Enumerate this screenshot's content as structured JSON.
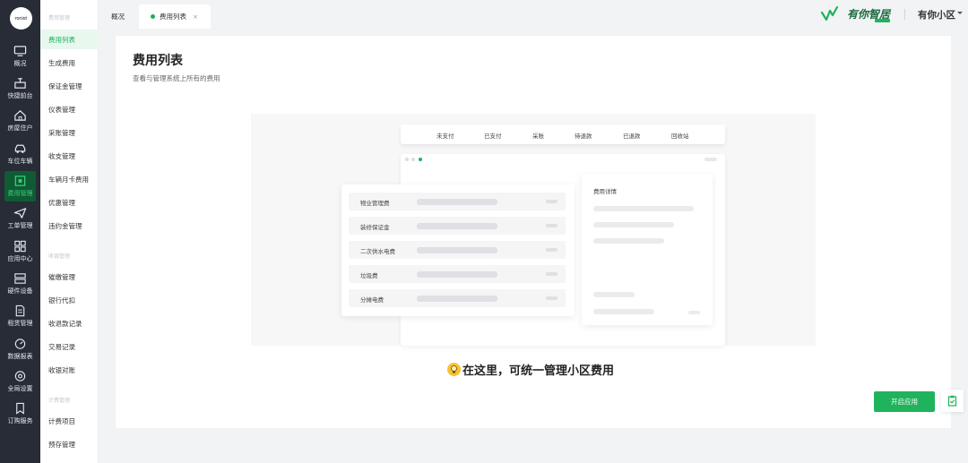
{
  "logo": {
    "text": "roniot"
  },
  "rail": {
    "items": [
      {
        "label": "概况",
        "icon": "monitor-icon"
      },
      {
        "label": "快捷前台",
        "icon": "desk-icon"
      },
      {
        "label": "房屋住户",
        "icon": "house-icon"
      },
      {
        "label": "车位车辆",
        "icon": "car-icon"
      },
      {
        "label": "费用管理",
        "icon": "fee-icon",
        "active": true
      },
      {
        "label": "工单管理",
        "icon": "paper-plane-icon"
      },
      {
        "label": "应用中心",
        "icon": "apps-grid-icon"
      },
      {
        "label": "硬件设备",
        "icon": "server-icon"
      },
      {
        "label": "租赁管理",
        "icon": "document-icon"
      },
      {
        "label": "数据报表",
        "icon": "gauge-icon"
      },
      {
        "label": "全局设置",
        "icon": "settings-icon"
      },
      {
        "label": "订购服务",
        "icon": "bookmark-icon"
      }
    ]
  },
  "submenu": {
    "group1": "费用管理",
    "group1_items": [
      "费用列表",
      "生成费用",
      "保证金管理",
      "仪表管理",
      "采账管理",
      "收支管理",
      "车辆月卡费用",
      "优惠管理",
      "违约金管理"
    ],
    "group2": "收银管理",
    "group2_items": [
      "催缴管理",
      "银行代扣",
      "收退款记录",
      "交易记录",
      "收银对账"
    ],
    "group3": "计费管理",
    "group3_items": [
      "计费项目",
      "预存管理"
    ]
  },
  "tabs": {
    "overview": "概况",
    "fee_list": "费用列表",
    "close": "×"
  },
  "brand": {
    "name": "有你智居"
  },
  "community": {
    "name": "有你小区"
  },
  "page": {
    "title": "费用列表",
    "subtitle": "查看与管理系统上所有的费用"
  },
  "illustration": {
    "tabs": [
      "未支付",
      "已支付",
      "采账",
      "待退款",
      "已退款",
      "回收站"
    ],
    "rows": [
      "物业管理费",
      "装修保证金",
      "二次供水电费",
      "垃圾费",
      "分摊电费"
    ],
    "detail_title": "费用详情"
  },
  "promo": {
    "text": "在这里，可统一管理小区费用"
  },
  "actions": {
    "enable": "开启应用"
  },
  "colors": {
    "accent": "#1fb35c",
    "rail_bg": "#272c36",
    "brand_dark": "#1b6a3f"
  }
}
